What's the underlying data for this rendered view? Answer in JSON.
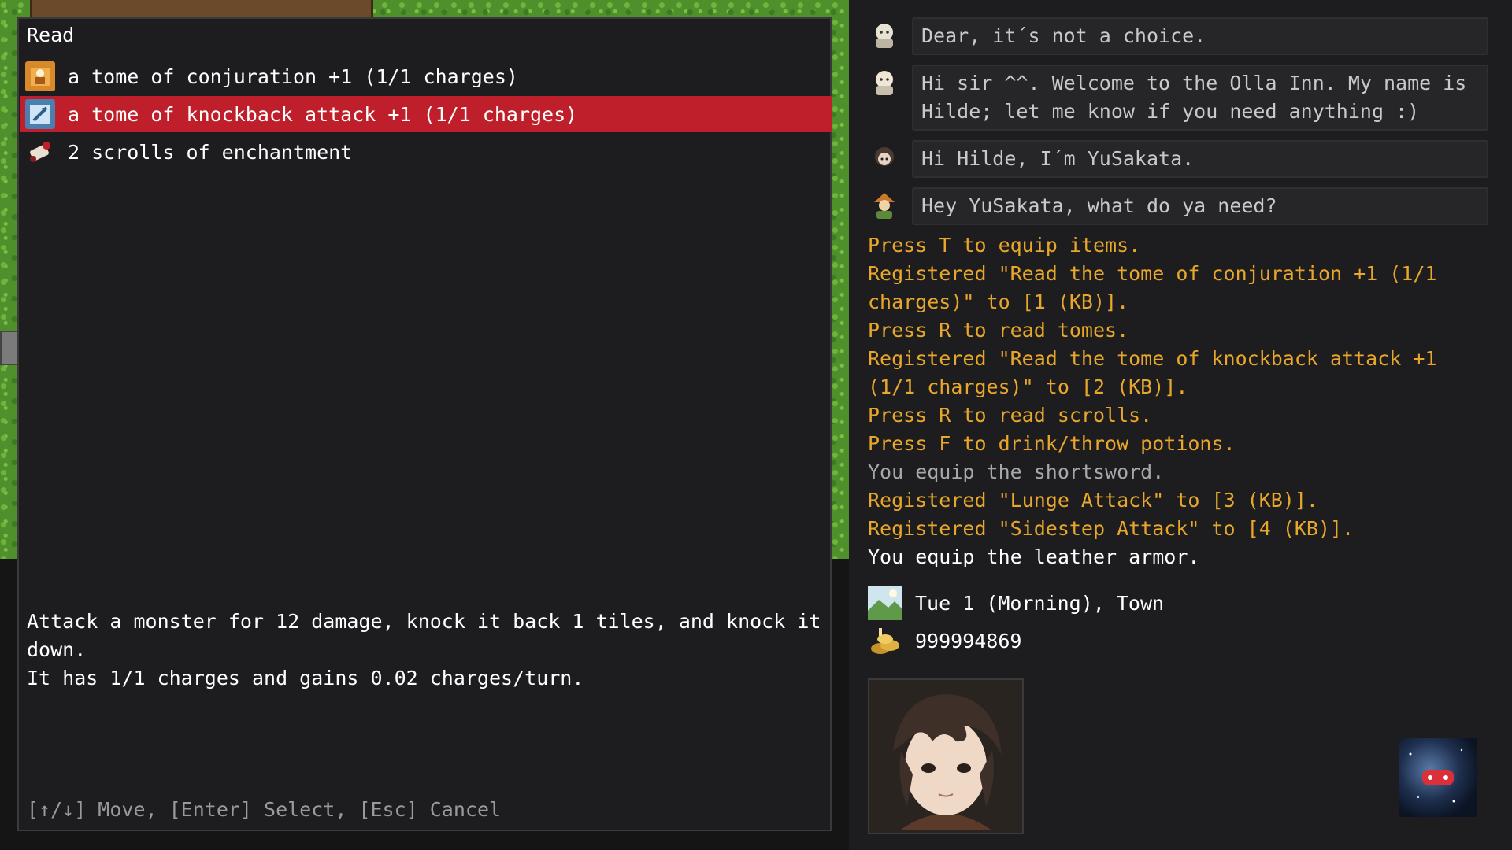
{
  "read_menu": {
    "title": "Read",
    "items": [
      {
        "label": "a tome of conjuration +1 (1/1 charges)",
        "icon": "conjuration-tome-icon",
        "selected": false
      },
      {
        "label": "a tome of knockback attack +1 (1/1 charges)",
        "icon": "knockback-tome-icon",
        "selected": true
      },
      {
        "label": "2 scrolls of enchantment",
        "icon": "enchantment-scroll-icon",
        "selected": false
      }
    ],
    "description": [
      "Attack a monster for 12 damage, knock it back 1 tiles, and knock it down.",
      "It has 1/1 charges and gains 0.02 charges/turn."
    ],
    "controls_hint": "[↑/↓] Move, [Enter] Select, [Esc] Cancel"
  },
  "chat": [
    {
      "speaker_icon": "innkeeper-portrait-icon",
      "text": "Dear, it´s not a choice."
    },
    {
      "speaker_icon": "hilde-portrait-icon",
      "text": "Hi sir ^^. Welcome to the Olla Inn. My name is Hilde; let me know if you need anything :)"
    },
    {
      "speaker_icon": "player-portrait-icon",
      "text": "Hi Hilde, I´m YuSakata."
    },
    {
      "speaker_icon": "npc-portrait-icon",
      "text": "Hey YuSakata, what do ya need?"
    }
  ],
  "log": [
    {
      "text": "Press T to equip items.",
      "kind": "system"
    },
    {
      "text": "Registered \"Read the tome of conjuration +1 (1/1 charges)\" to [1 (KB)].",
      "kind": "system"
    },
    {
      "text": "Press R to read tomes.",
      "kind": "system"
    },
    {
      "text": "Registered \"Read the tome of knockback attack +1 (1/1 charges)\" to [2 (KB)].",
      "kind": "system"
    },
    {
      "text": "Press R to read scrolls.",
      "kind": "system"
    },
    {
      "text": "Press F to drink/throw potions.",
      "kind": "system"
    },
    {
      "text": "You equip the shortsword.",
      "kind": "note"
    },
    {
      "text": "Registered \"Lunge Attack\" to [3 (KB)].",
      "kind": "system"
    },
    {
      "text": "Registered \"Sidestep Attack\" to [4 (KB)].",
      "kind": "system"
    },
    {
      "text": "You equip the leather armor.",
      "kind": "info"
    }
  ],
  "status": {
    "date_location": "Tue 1 (Morning), Town",
    "gold": "999994869"
  },
  "colors": {
    "selection": "#bf1f2a",
    "system_text": "#e8a72b",
    "panel_bg": "#1d1d1f"
  }
}
